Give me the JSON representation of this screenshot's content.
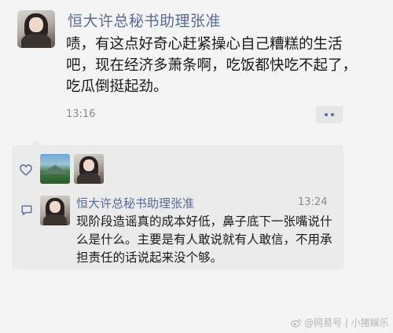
{
  "moment": {
    "poster_name": "恒大许总秘书助理张准",
    "text": "啧，有这点好奇心赶紧操心自己糟糕的生活吧，现在经济多萧条啊，吃饭都快吃不起了，吃瓜倒挺起劲。",
    "time": "13:16"
  },
  "interactions": {
    "likes": [
      "landscape-avatar",
      "woman-avatar"
    ],
    "comments": [
      {
        "name": "恒大许总秘书助理张准",
        "time": "13:24",
        "text": "现阶段造谣真的成本好低，鼻子底下一张嘴说什么是什么。主要是有人敢说就有人敢信，不用承担责任的话说起来没个够。"
      }
    ]
  },
  "watermark": "@网易号 | 小猪娱乐",
  "colors": {
    "name_link": "#576b95",
    "background": "#f4f4f4",
    "comment_panel": "#ebebeb"
  }
}
